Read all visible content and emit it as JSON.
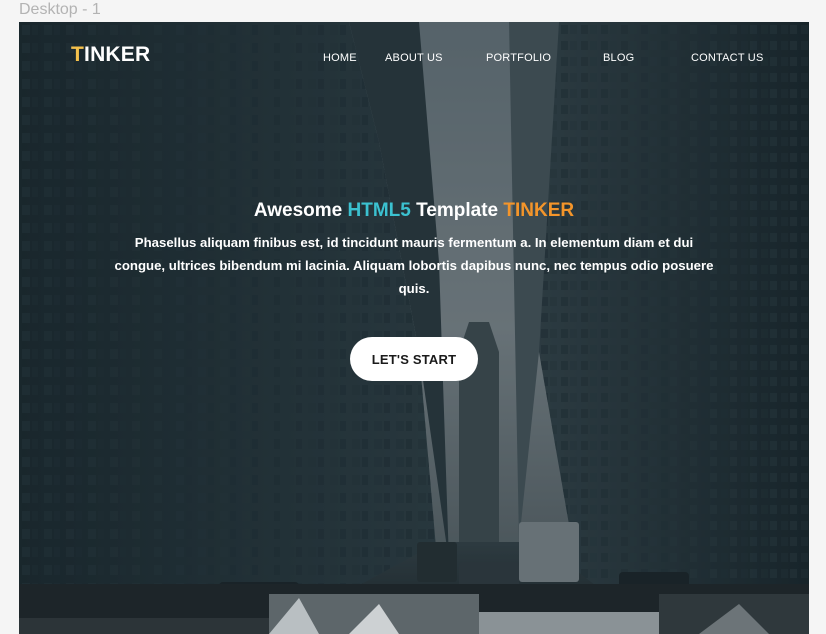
{
  "canvas": {
    "frame_label": "Desktop - 1"
  },
  "brand": {
    "first_letter": "T",
    "rest": "INKER"
  },
  "nav": {
    "items": [
      {
        "label": "HOME"
      },
      {
        "label": "ABOUT US"
      },
      {
        "label": "PORTFOLIO"
      },
      {
        "label": "BLOG"
      },
      {
        "label": "CONTACT US"
      }
    ]
  },
  "hero": {
    "title_part1": "Awesome",
    "title_part2": "HTML5",
    "title_part3": "Template",
    "title_part4": "TINKER",
    "text": "Phasellus aliquam finibus est, id tincidunt mauris fermentum a. In elementum diam et dui congue, ultrices bibendum mi lacinia. Aliquam lobortis dapibus nunc, nec tempus odio posuere quis.",
    "cta_label": "LET'S START"
  },
  "colors": {
    "logo_accent": "#f5c14c",
    "html5_accent": "#3bc1d0",
    "brand_accent": "#f4952a",
    "cta_background": "#ffffff"
  }
}
